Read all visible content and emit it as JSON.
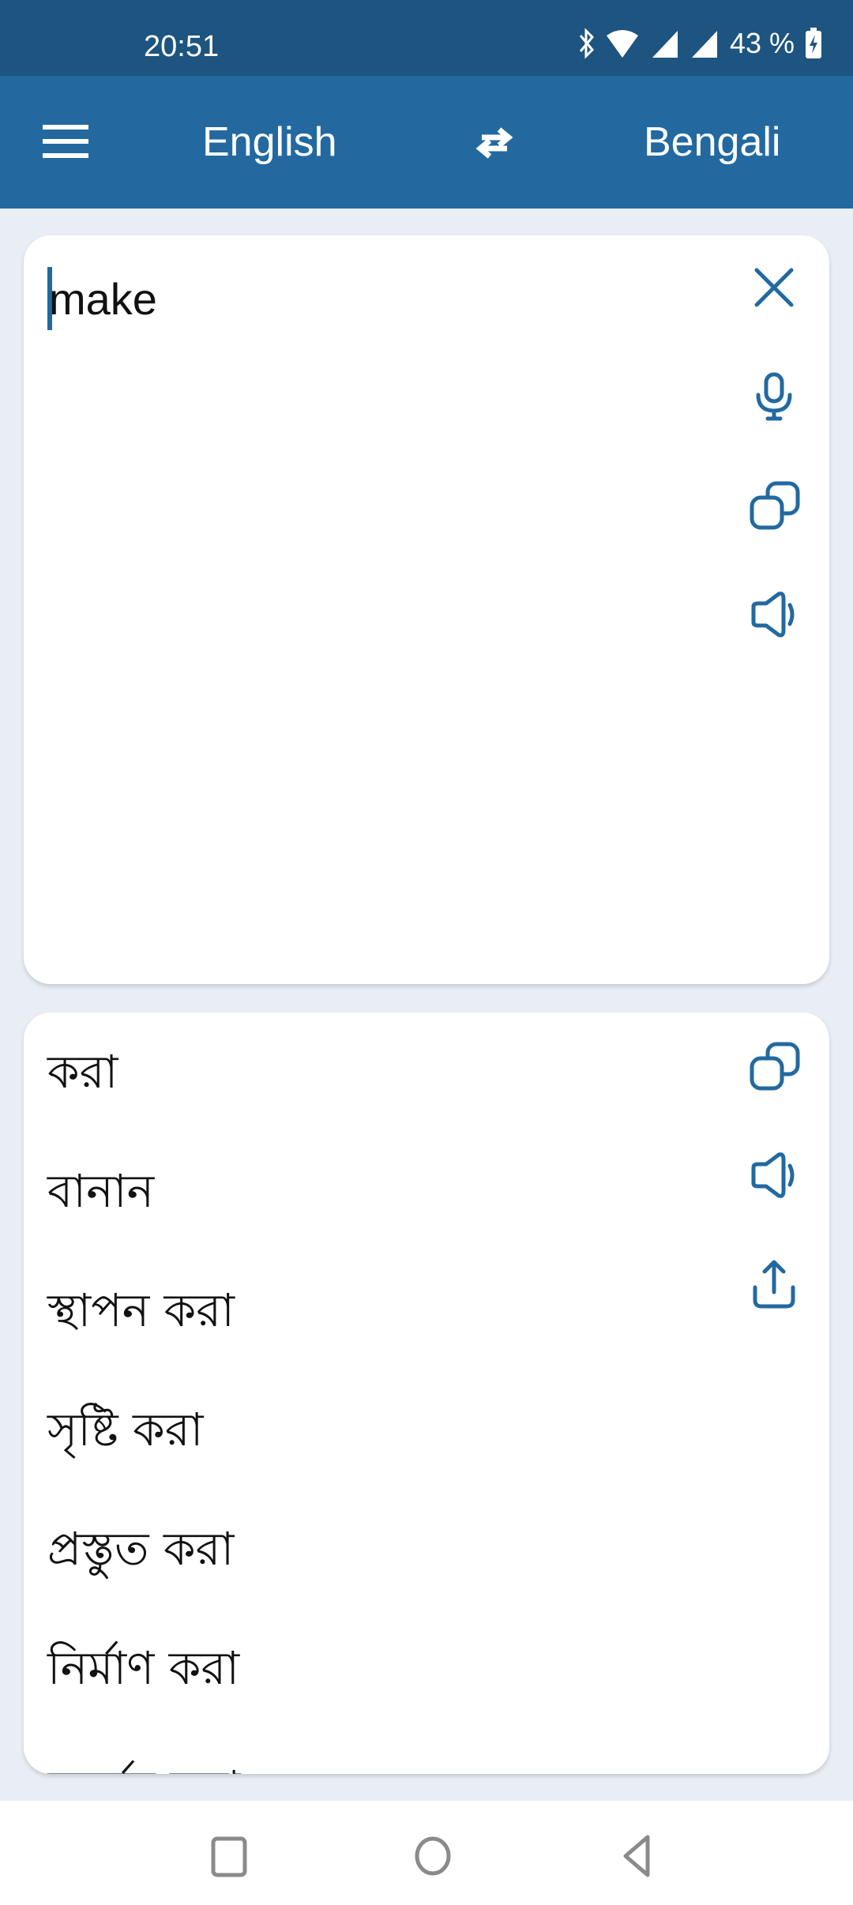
{
  "status_bar": {
    "time": "20:51",
    "battery": "43 %",
    "icons": [
      "bluetooth-icon",
      "wifi-icon",
      "signal-icon",
      "signal-icon",
      "battery-charging-icon"
    ]
  },
  "app_bar": {
    "source_language": "English",
    "target_language": "Bengali",
    "menu_icon": "hamburger-menu-icon",
    "swap_icon": "swap-arrows-icon"
  },
  "input": {
    "text": "make",
    "actions": [
      "clear",
      "microphone",
      "copy",
      "speak"
    ]
  },
  "output": {
    "results": [
      "করা",
      "বানান",
      "স্থাপন করা",
      "সৃষ্টি করা",
      "প্রস্তুত করা",
      "নির্মাণ করা",
      "অর্জন করা"
    ],
    "actions": [
      "copy",
      "speak",
      "share"
    ]
  },
  "colors": {
    "status_bar": "#1d5480",
    "app_bar": "#2369a0",
    "accent": "#2369a0",
    "background": "#e9eef5"
  },
  "nav_bar": {
    "buttons": [
      "recents",
      "home",
      "back"
    ]
  }
}
